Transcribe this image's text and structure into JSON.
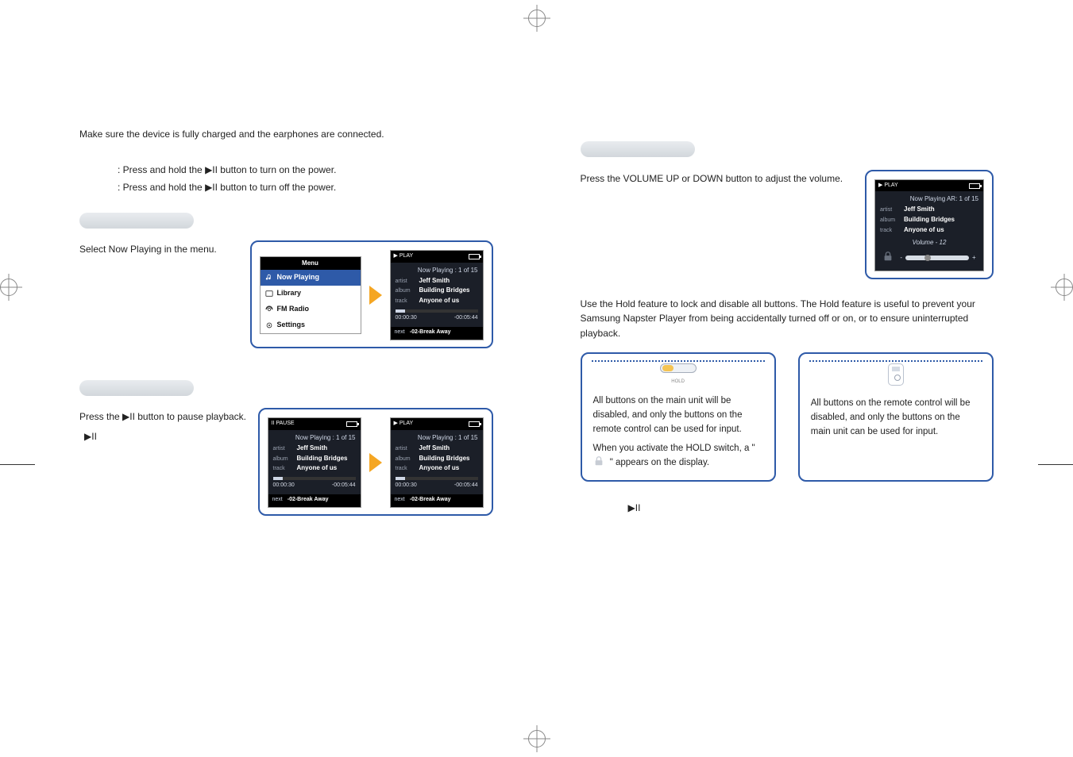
{
  "left": {
    "intro": "Make sure the device is fully charged and the earphones are connected.",
    "power_on": ": Press and hold the ▶II button to turn on the power.",
    "power_off": ": Press and hold the ▶II button to turn off the power.",
    "playing_music": {
      "text": "Select Now Playing in the menu.",
      "menu": {
        "title": "Menu",
        "items": [
          "Now Playing",
          "Library",
          "FM Radio",
          "Settings"
        ]
      }
    },
    "pausing": {
      "text": "Press the ▶II button to pause playback.",
      "note_prefix": "▶II"
    }
  },
  "screens": {
    "np": {
      "status_play": "▶ PLAY",
      "status_pause": "II PAUSE",
      "nowplaying": "Now Playing : 1 of 15",
      "nowplaying_alt": "Now Playing AR: 1 of 15",
      "artist_k": "artist",
      "artist": "Jeff Smith",
      "album_k": "album",
      "album": "Building Bridges",
      "track_k": "track",
      "track": "Anyone of us",
      "t_elapsed": "00:00:30",
      "t_remain": "-00:05:44",
      "next_k": "next",
      "next": "-02-Break Away",
      "volume_label": "Volume - 12"
    }
  },
  "right": {
    "volume_text": "Press the VOLUME UP or DOWN button to adjust the volume.",
    "hold_intro": "Use the Hold feature to lock and disable all buttons. The Hold feature is useful to prevent your Samsung Napster Player from being accidentally turned off or on, or to ensure uninterrupted playback.",
    "hold_main_1": "All buttons on the main unit will be disabled, and only the buttons on the remote control can be used for input.",
    "hold_main_2a": "When you activate the HOLD switch, a \"",
    "hold_main_2b": "\" appears on the display.",
    "hold_remote": "All buttons on the remote control will be disabled, and only the buttons on the main unit can be used for input.",
    "footer_glyph": "▶II"
  },
  "page_left": "",
  "page_right": ""
}
